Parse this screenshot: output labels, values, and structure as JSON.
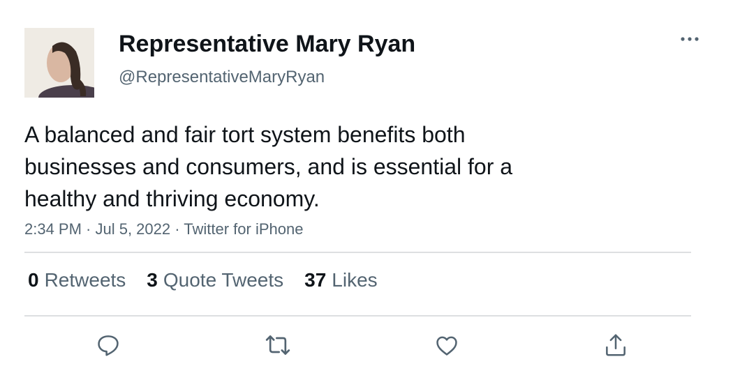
{
  "author": {
    "name": "Representative Mary Ryan",
    "handle": "@RepresentativeMaryRyan",
    "avatar": "avatar-photo"
  },
  "tweet": {
    "lines": [
      "A balanced and fair tort system benefits both",
      "businesses and consumers, and is essential for a",
      "healthy and thriving economy."
    ],
    "meta": "2:34 PM · Jul 5, 2022 · Twitter for iPhone"
  },
  "stats": [
    {
      "count": "0",
      "label": "Retweets"
    },
    {
      "count": "3",
      "label": "Quote Tweets"
    },
    {
      "count": "37",
      "label": "Likes"
    }
  ],
  "actions": [
    "reply-icon",
    "retweet-icon",
    "like-icon",
    "share-icon"
  ],
  "icons": {
    "more": "more-icon"
  },
  "colors": {
    "text": "#0f1419",
    "secondary": "#536471",
    "divider": "#dddfe1"
  }
}
